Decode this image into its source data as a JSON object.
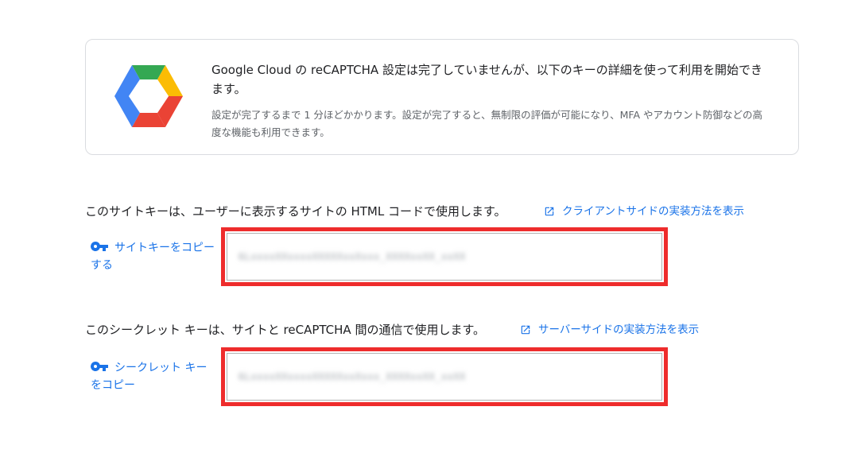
{
  "notice": {
    "title": "Google Cloud の reCAPTCHA 設定は完了していませんが、以下のキーの詳細を使って利用を開始できます。",
    "body": "設定が完了するまで 1 分ほどかかります。設定が完了すると、無制限の評価が可能になり、MFA やアカウント防御などの高度な機能も利用できます。"
  },
  "site_key": {
    "description": "このサイトキーは、ユーザーに表示するサイトの HTML コードで使用します。",
    "link_label": "クライアントサイドの実装方法を表示",
    "copy_label": "サイトキーをコピーする",
    "value": "6LxxxxXXxxxxXXXXXxxXxxx_XXXXxxXX_xxXX"
  },
  "secret_key": {
    "description": "このシークレット キーは、サイトと reCAPTCHA 間の通信で使用します。",
    "link_label": "サーバーサイドの実装方法を表示",
    "copy_label": "シークレット キーをコピー",
    "value": "6LxxxxXXxxxxXXXXXxxXxxx_XXXXxxXX_xxXX"
  },
  "colors": {
    "link": "#1a73e8",
    "highlight_border": "#ee2c2c",
    "logo_green": "#34a853",
    "logo_yellow": "#fbbc04",
    "logo_red": "#ea4335",
    "logo_blue": "#4285f4"
  },
  "icons": {
    "logo": "google-cloud-logo",
    "external_link": "open-in-new-icon",
    "key": "vpn-key-icon"
  }
}
